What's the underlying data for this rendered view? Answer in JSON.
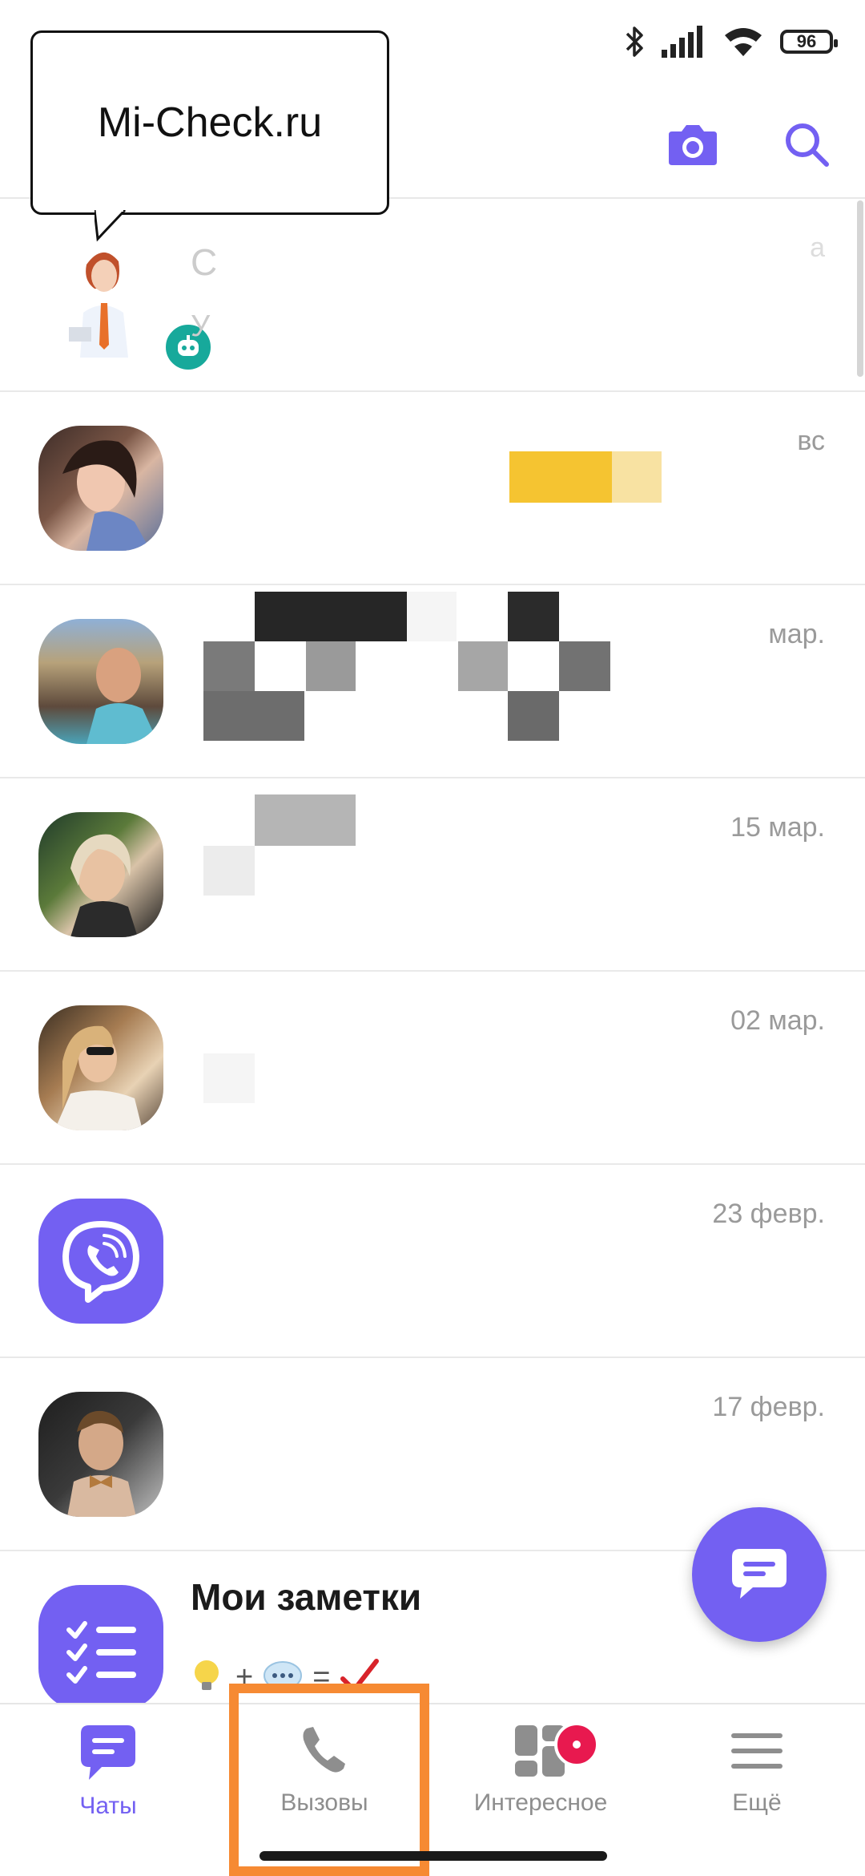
{
  "status_bar": {
    "battery": "96"
  },
  "watermark": {
    "text": "Mi-Check.ru"
  },
  "header": {
    "camera_icon": "camera-icon",
    "search_icon": "search-icon",
    "accent": "#7360f2"
  },
  "chats": [
    {
      "name": "С",
      "snippet": "У",
      "date": "а",
      "avatar": "assistant-bot"
    },
    {
      "name": "",
      "snippet": "",
      "date": "вс",
      "avatar": "photo-woman-1"
    },
    {
      "name": "",
      "snippet": "",
      "date": "мар.",
      "avatar": "photo-man-1"
    },
    {
      "name": "",
      "snippet": "",
      "date": "15 мар.",
      "avatar": "photo-woman-2"
    },
    {
      "name": "",
      "snippet": "",
      "date": "02 мар.",
      "avatar": "photo-woman-3"
    },
    {
      "name": "",
      "snippet": "",
      "date": "23 февр.",
      "avatar": "viber-logo"
    },
    {
      "name": "",
      "snippet": "",
      "date": "17 февр.",
      "avatar": "photo-man-2"
    },
    {
      "name": "Мои заметки",
      "snippet": "",
      "date": "",
      "avatar": "notes-icon"
    }
  ],
  "notes_symbols": {
    "plus": "+",
    "equals": "="
  },
  "bottom_nav": [
    {
      "label": "Чаты",
      "icon": "chat-icon",
      "active": true
    },
    {
      "label": "Вызовы",
      "icon": "phone-icon",
      "active": false
    },
    {
      "label": "Интересное",
      "icon": "explore-icon",
      "active": false
    },
    {
      "label": "Ещё",
      "icon": "menu-icon",
      "active": false
    }
  ]
}
